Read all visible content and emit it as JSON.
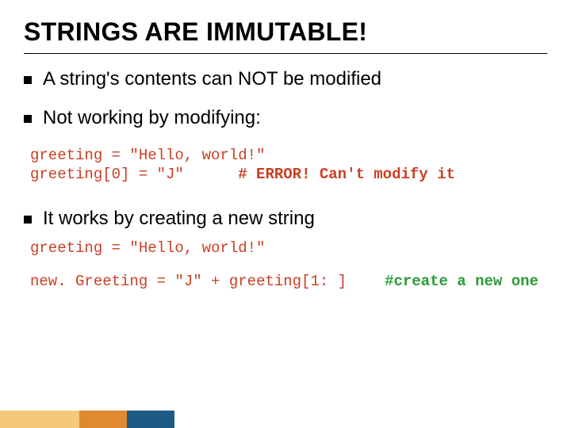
{
  "title": "STRINGS ARE IMMUTABLE!",
  "bul1": "A string's contents can NOT be modified",
  "bul2": "Not working by modifying:",
  "code1": {
    "l1": "greeting = \"Hello, world!\"",
    "l2a": "greeting[0] = \"J\"      ",
    "l2b": "# ERROR! Can't modify it"
  },
  "bul3": "It works by creating a new string",
  "code2": {
    "l1": "greeting = \"Hello, world!\""
  },
  "code3": {
    "l1": "new. Greeting = \"J\" + greeting[1: ]",
    "comment": "#create a new one"
  }
}
